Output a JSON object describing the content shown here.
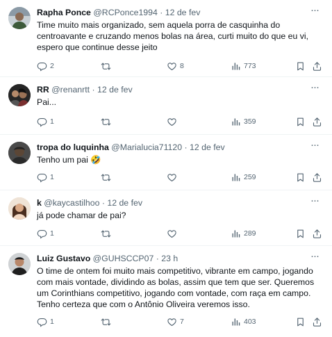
{
  "tweets": [
    {
      "name": "Rapha Ponce",
      "handle": "@RCPonce1994",
      "dot": "·",
      "time": "12 de fev",
      "text": "Time muito mais organizado, sem aquela porra de casquinha do centroavante e cruzando menos bolas na área, curti muito do que eu vi, espero que continue desse jeito",
      "replies": "2",
      "retweets": "",
      "likes": "8",
      "views": "773"
    },
    {
      "name": "RR",
      "handle": "@renanrtt",
      "dot": "·",
      "time": "12 de fev",
      "text": "Pai...",
      "replies": "1",
      "retweets": "",
      "likes": "",
      "views": "359"
    },
    {
      "name": "tropa do luquinha",
      "handle": "@Marialucia71120",
      "dot": "·",
      "time": "12 de fev",
      "text": "Tenho um pai 🤣",
      "replies": "1",
      "retweets": "",
      "likes": "",
      "views": "259"
    },
    {
      "name": "k",
      "handle": "@kaycastilhoo",
      "dot": "·",
      "time": "12 de fev",
      "text": "já pode chamar de pai?",
      "replies": "1",
      "retweets": "",
      "likes": "",
      "views": "289"
    },
    {
      "name": "Luiz Gustavo",
      "handle": "@GUHSCCP07",
      "dot": "·",
      "time": "23 h",
      "text": "O time de ontem foi muito mais competitivo, vibrante em campo, jogando com mais vontade, dividindo as bolas, assim que tem que ser. Queremos um Corinthians competitivo, jogando com vontade, com raça em campo. Tenho certeza que com o Antônio Oliveira veremos isso.",
      "replies": "1",
      "retweets": "",
      "likes": "7",
      "views": "403"
    }
  ],
  "more_glyph": "···",
  "colors": {
    "text": "#0f1419",
    "muted": "#536471",
    "border": "#eff3f4"
  }
}
